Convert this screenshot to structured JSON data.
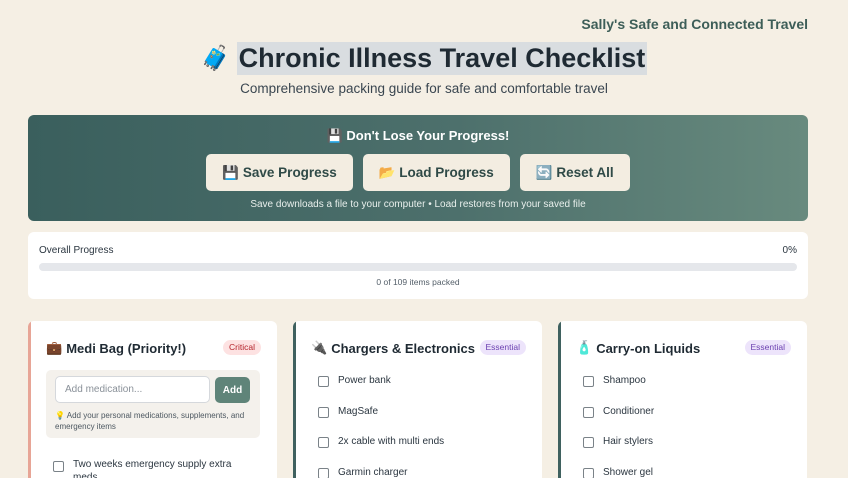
{
  "brand": "Sally's Safe and Connected Travel",
  "header": {
    "icon": "luggage-emoji",
    "icon_glyph": "🧳",
    "title": "Chronic Illness Travel Checklist",
    "subtitle": "Comprehensive packing guide for safe and comfortable travel"
  },
  "save_panel": {
    "heading": "💾 Don't Lose Your Progress!",
    "buttons": {
      "save": "💾 Save Progress",
      "load": "📂 Load Progress",
      "reset": "🔄 Reset All"
    },
    "note": "Save downloads a file to your computer • Load restores from your saved file"
  },
  "progress": {
    "label": "Overall Progress",
    "percent_text": "0%",
    "fraction": 0,
    "count_text": "0 of 109 items packed"
  },
  "cards": [
    {
      "icon_glyph": "💼",
      "title": "Medi Bag (Priority!)",
      "badge": "Critical",
      "input_placeholder": "Add medication...",
      "add_label": "Add",
      "hint": "💡 Add your personal medications, supplements, and emergency items",
      "items": [
        "Two weeks emergency supply extra meds"
      ]
    },
    {
      "icon_glyph": "🔌",
      "title": "Chargers & Electronics",
      "badge": "Essential",
      "items": [
        "Power bank",
        "MagSafe",
        "2x cable with multi ends",
        "Garmin charger"
      ]
    },
    {
      "icon_glyph": "🧴",
      "title": "Carry-on Liquids",
      "badge": "Essential",
      "items": [
        "Shampoo",
        "Conditioner",
        "Hair stylers",
        "Shower gel"
      ]
    }
  ],
  "colors": {
    "accent": "#4d706c",
    "background": "#f5efe4",
    "critical": "#b4232b",
    "essential": "#6b3fb0"
  }
}
